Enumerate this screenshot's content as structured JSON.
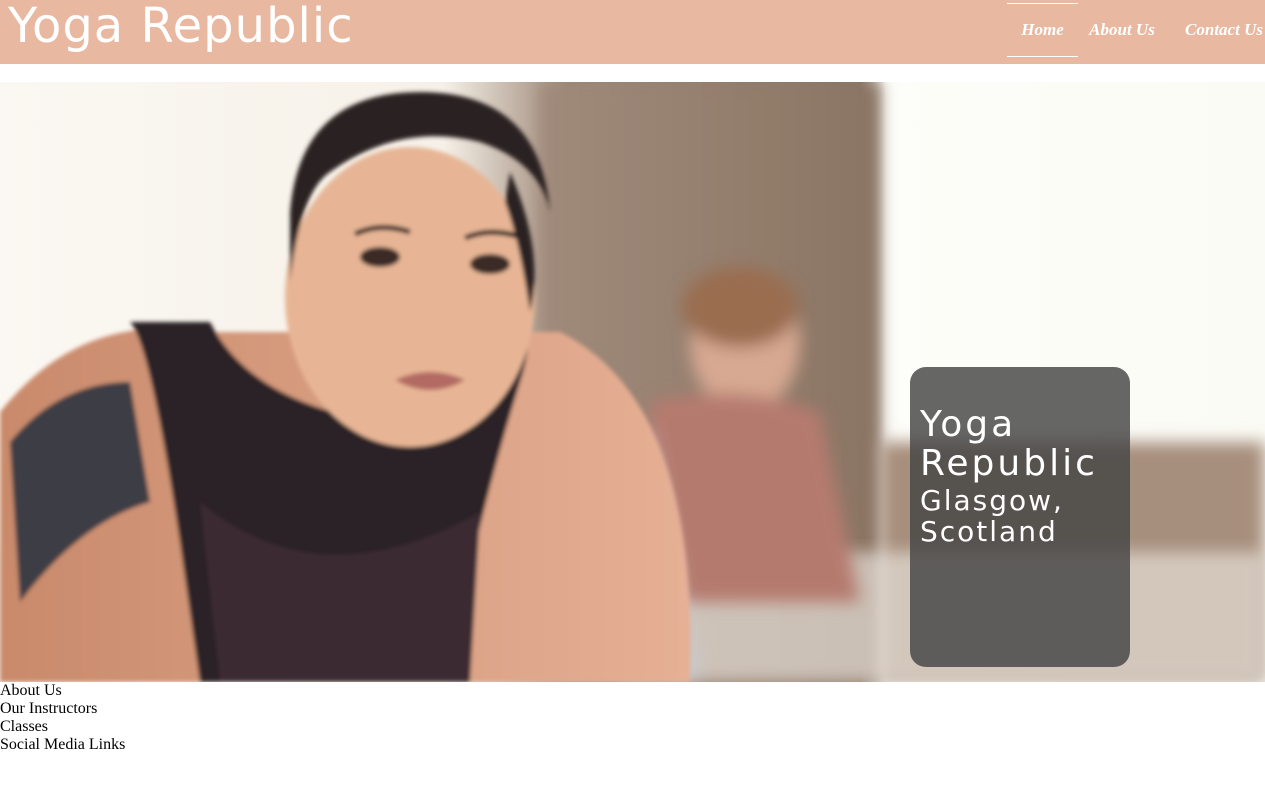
{
  "header": {
    "brand": "Yoga Republic",
    "nav": [
      {
        "label": "Home",
        "active": true
      },
      {
        "label": "About Us",
        "active": false
      },
      {
        "label": "Contact Us",
        "active": false
      }
    ]
  },
  "hero": {
    "title": "Yoga Republic",
    "subtitle": "Glasgow, Scotland"
  },
  "links": [
    "About Us",
    "Our Instructors",
    "Classes",
    "Social Media Links"
  ],
  "colors": {
    "header_bg": "#e8b8a0",
    "card_bg": "#444444",
    "text_light": "#ffffff"
  }
}
